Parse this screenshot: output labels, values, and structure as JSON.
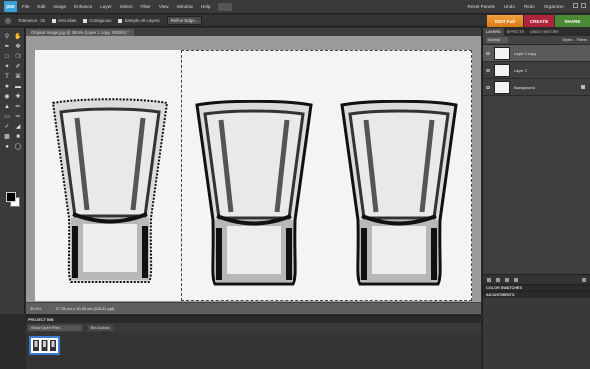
{
  "app": {
    "logo": "pse",
    "menu": [
      "File",
      "Edit",
      "Image",
      "Enhance",
      "Layer",
      "Select",
      "Filter",
      "View",
      "Window",
      "Help"
    ],
    "right_tools": [
      "Reset Panels",
      "Undo",
      "Redo",
      "Organizer"
    ]
  },
  "options": {
    "tolerance_label": "Tolerance:",
    "tolerance_value": "32",
    "antialias": "Anti-alias",
    "contiguous": "Contiguous",
    "sample_all": "Sample All Layers",
    "refine": "Refine Edge..."
  },
  "mode_tabs": {
    "edit": "EDIT Full",
    "create": "CREATE",
    "share": "SHARE"
  },
  "document": {
    "tab": "Original Image.jpg @ 38.6% (Layer 1 copy, RGB/8) *",
    "zoom": "38.6%",
    "info": "17.78 cm x 10.26 cm (118.11 ppi)"
  },
  "panels": {
    "tabs": [
      "LAYERS",
      "EFFECTS",
      "UNDO HISTORY"
    ],
    "subtabs": [
      "Styles",
      "Filters"
    ],
    "blend_mode": "Normal",
    "opacity_label": "Opacity:",
    "opacity_value": "",
    "layers": [
      {
        "name": "Layer 1 copy"
      },
      {
        "name": "Layer 1"
      },
      {
        "name": "Background"
      }
    ],
    "color_swatches": "COLOR SWATCHES",
    "adjustments": "ADJUSTMENTS"
  },
  "project_bin": {
    "title": "PROJECT BIN",
    "show": "Show Open Files",
    "bin_actions": "Bin Actions"
  },
  "colors": {
    "edit": "#e88a20",
    "create": "#b0243b",
    "share": "#4b8a34",
    "accent": "#3b7bd0"
  }
}
